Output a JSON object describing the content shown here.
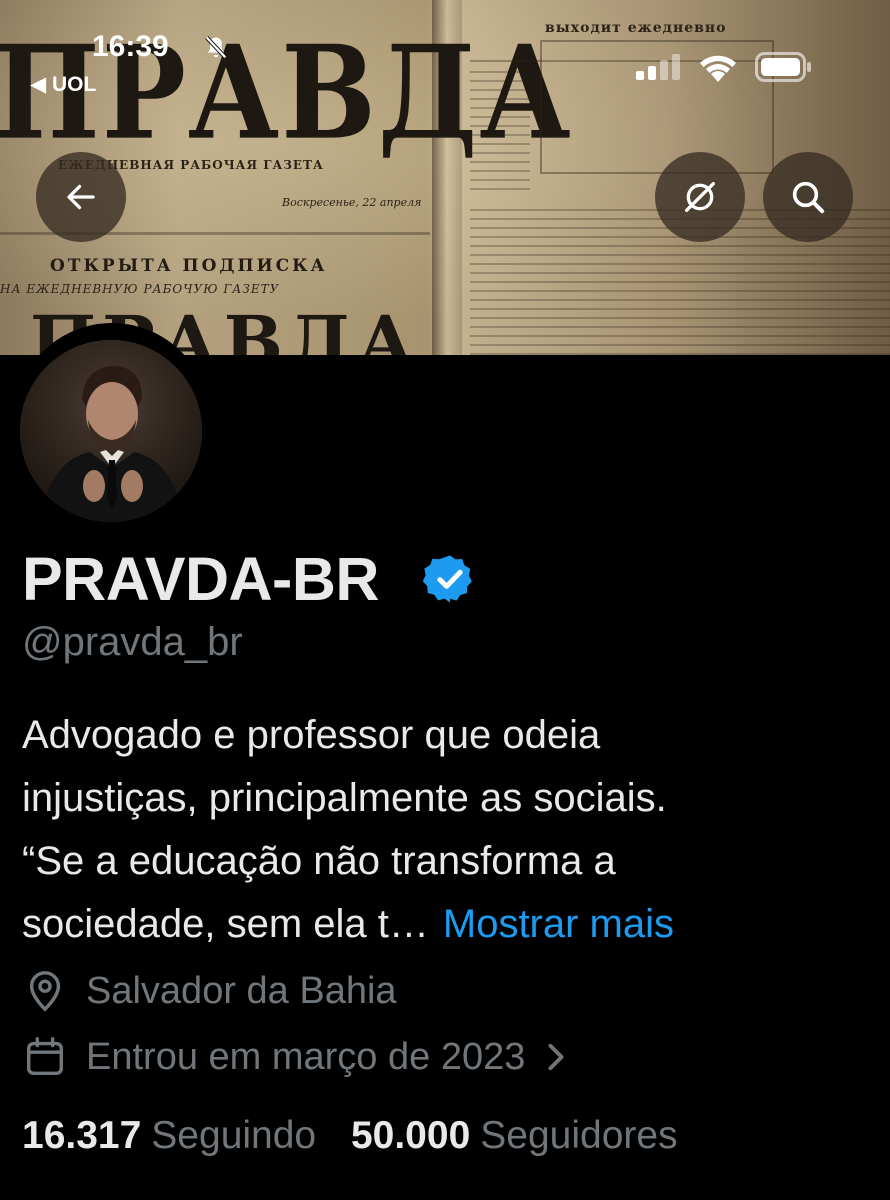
{
  "status_bar": {
    "time": "16:39",
    "back_app": "◀ UOL",
    "icons": [
      "bell-muted-icon",
      "cellular-signal-icon",
      "wifi-icon",
      "battery-icon"
    ]
  },
  "banner": {
    "masthead": "ПРАВДА",
    "sub_masthead": "ЕЖЕДНЕВНАЯ РАБОЧАЯ ГАЗЕТА",
    "headline": "ОТКРЫТА ПОДПИСКА",
    "subline": "НА ЕЖЕДНЕВНУЮ РАБОЧУЮ ГАЗЕТУ",
    "masthead2": "ПРАВДА",
    "right_head": "выходит ежедневно",
    "date_line": "Воскресенье, 22 апреля"
  },
  "nav": {
    "back_icon": "arrow-left-icon",
    "mode_icon": "circle-slash-icon",
    "search_icon": "search-icon"
  },
  "profile": {
    "display_name": "PRAVDA-BR",
    "verified_icon": "verified-badge-icon",
    "handle": "@pravda_br",
    "bio_lines": [
      "Advogado e professor que odeia",
      "injustiças, principalmente as sociais.",
      "“Se a educação não transforma a",
      "sociedade, sem ela t…"
    ],
    "show_more": "Mostrar mais",
    "location": "Salvador da Bahia",
    "joined": "Entrou em março de 2023",
    "following_count": "16.317",
    "following_label": "Seguindo",
    "followers_count": "50.000",
    "followers_label": "Seguidores"
  },
  "colors": {
    "background": "#000000",
    "text_primary": "#e7e9ea",
    "text_secondary": "#71767b",
    "link": "#1d9bf0",
    "verified": "#1d9bf0"
  }
}
